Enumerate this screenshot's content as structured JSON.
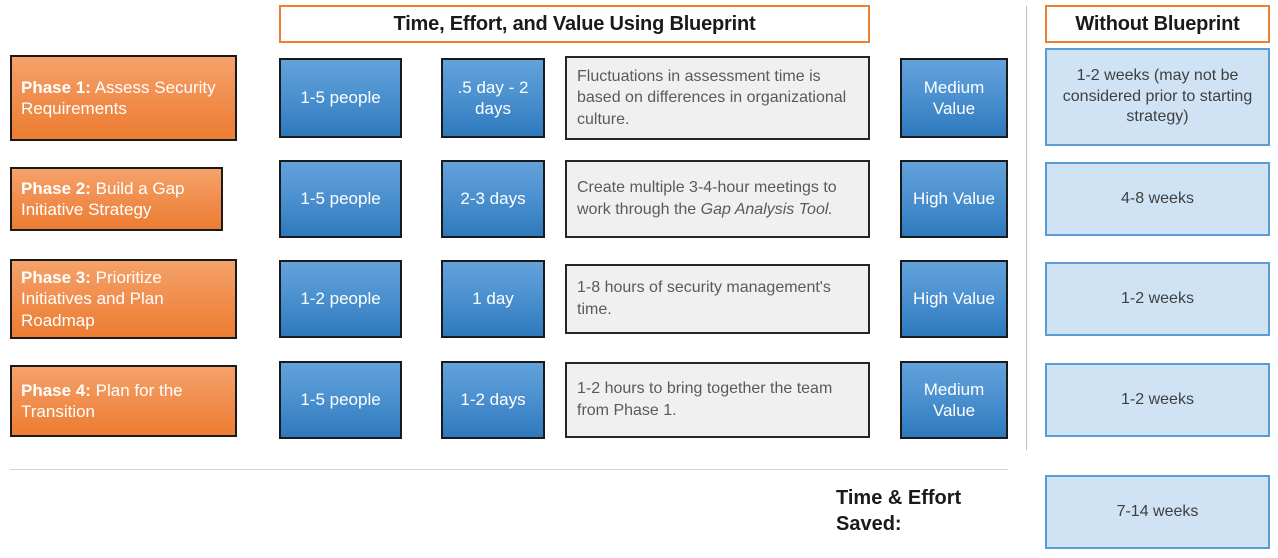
{
  "headers": {
    "main_banner": "Time, Effort, and Value Using Blueprint",
    "without_banner": "Without Blueprint"
  },
  "colors": {
    "accent_orange": "#ED7D31",
    "phase_fill": "#F08C4B",
    "blue_fill": "#2E79BD",
    "light_blue_fill": "#CFE3F5",
    "light_blue_border": "#5B9BD5",
    "desc_fill": "#F0F0F0",
    "divider": "#BFBFBF"
  },
  "rows": [
    {
      "phase_lead": "Phase 1:",
      "phase_rest": " Assess Security Requirements",
      "people": "1-5 people",
      "time": ".5 day - 2 days",
      "note_plain": "Fluctuations in assessment time is based on differences in organizational culture.",
      "note_italic": "",
      "value": "Medium Value",
      "without": "1-2 weeks (may not be considered prior to starting strategy)"
    },
    {
      "phase_lead": "Phase 2:",
      "phase_rest": " Build a Gap Initiative Strategy",
      "people": "1-5 people",
      "time": "2-3 days",
      "note_plain": "Create multiple 3-4-hour meetings to work through the ",
      "note_italic": "Gap Analysis Tool.",
      "value": "High Value",
      "without": "4-8 weeks"
    },
    {
      "phase_lead": "Phase 3:",
      "phase_rest": " Prioritize Initiatives and Plan Roadmap",
      "people": "1-2 people",
      "time": "1 day",
      "note_plain": "1-8 hours of security management's time.",
      "note_italic": "",
      "value": "High Value",
      "without": "1-2 weeks"
    },
    {
      "phase_lead": "Phase 4:",
      "phase_rest": " Plan for the Transition",
      "people": "1-5 people",
      "time": "1-2 days",
      "note_plain": "1-2 hours to bring together the team from Phase 1.",
      "note_italic": "",
      "value": "Medium Value",
      "without": "1-2 weeks"
    }
  ],
  "summary": {
    "label": "Time & Effort Saved:",
    "total_saved": "7-14 weeks"
  }
}
